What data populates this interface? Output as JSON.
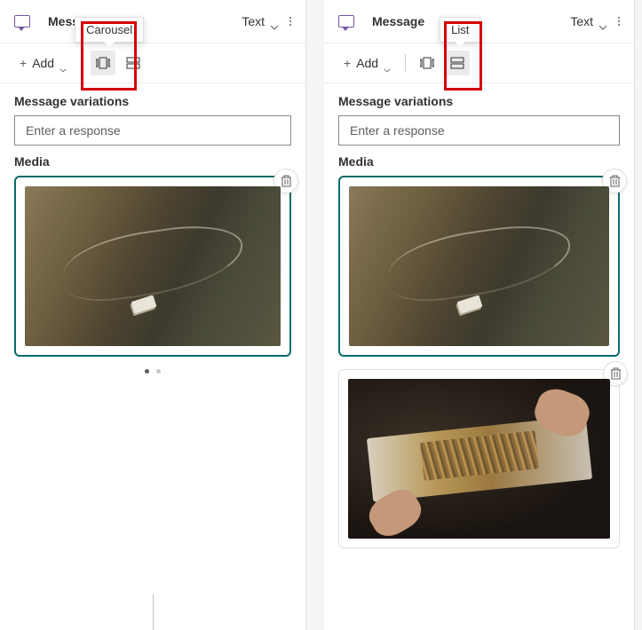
{
  "left": {
    "header": {
      "title": "Message",
      "dropdown": "Text"
    },
    "toolbar": {
      "add": "Add",
      "tooltip": "Carousel"
    },
    "variations_label": "Message variations",
    "response_placeholder": "Enter a response",
    "media_label": "Media"
  },
  "right": {
    "header": {
      "title": "Message",
      "dropdown": "Text"
    },
    "toolbar": {
      "add": "Add",
      "tooltip": "List"
    },
    "variations_label": "Message variations",
    "response_placeholder": "Enter a response",
    "media_label": "Media"
  }
}
